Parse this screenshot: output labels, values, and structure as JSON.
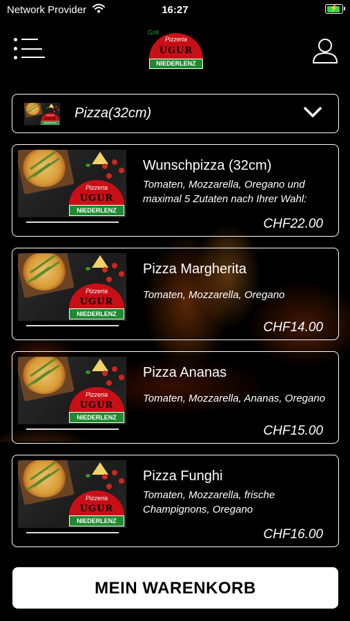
{
  "status_bar": {
    "carrier": "Network Provider",
    "time": "16:27",
    "battery_level": 0.9,
    "battery_color": "#2bd94a"
  },
  "header": {
    "logo": {
      "grill": "Grill",
      "pizzeria": "Pizzeria",
      "brand": "UGUR",
      "location": "NIEDERLENZ"
    },
    "menu_icon": "menu-icon",
    "profile_icon": "user-icon"
  },
  "category": {
    "label": "Pizza(32cm)",
    "icon": "chevron-down-icon"
  },
  "products": [
    {
      "title": "Wunschpizza (32cm)",
      "description": "Tomaten, Mozzarella, Oregano und maximal 5 Zutaten nach Ihrer Wahl:",
      "price": "CHF22.00"
    },
    {
      "title": "Pizza Margherita",
      "description": "Tomaten, Mozzarella, Oregano",
      "price": "CHF14.00"
    },
    {
      "title": "Pizza Ananas",
      "description": "Tomaten, Mozzarella, Ananas, Oregano",
      "price": "CHF15.00"
    },
    {
      "title": "Pizza Funghi",
      "description": "Tomaten, Mozzarella, frische Champignons, Oregano",
      "price": "CHF16.00"
    }
  ],
  "cart_button": {
    "label": "MEIN WARENKORB"
  },
  "colors": {
    "background": "#000000",
    "logo_red": "#c90f16",
    "logo_green": "#1f8a2f",
    "button_bg": "#ffffff",
    "button_text": "#000000"
  }
}
